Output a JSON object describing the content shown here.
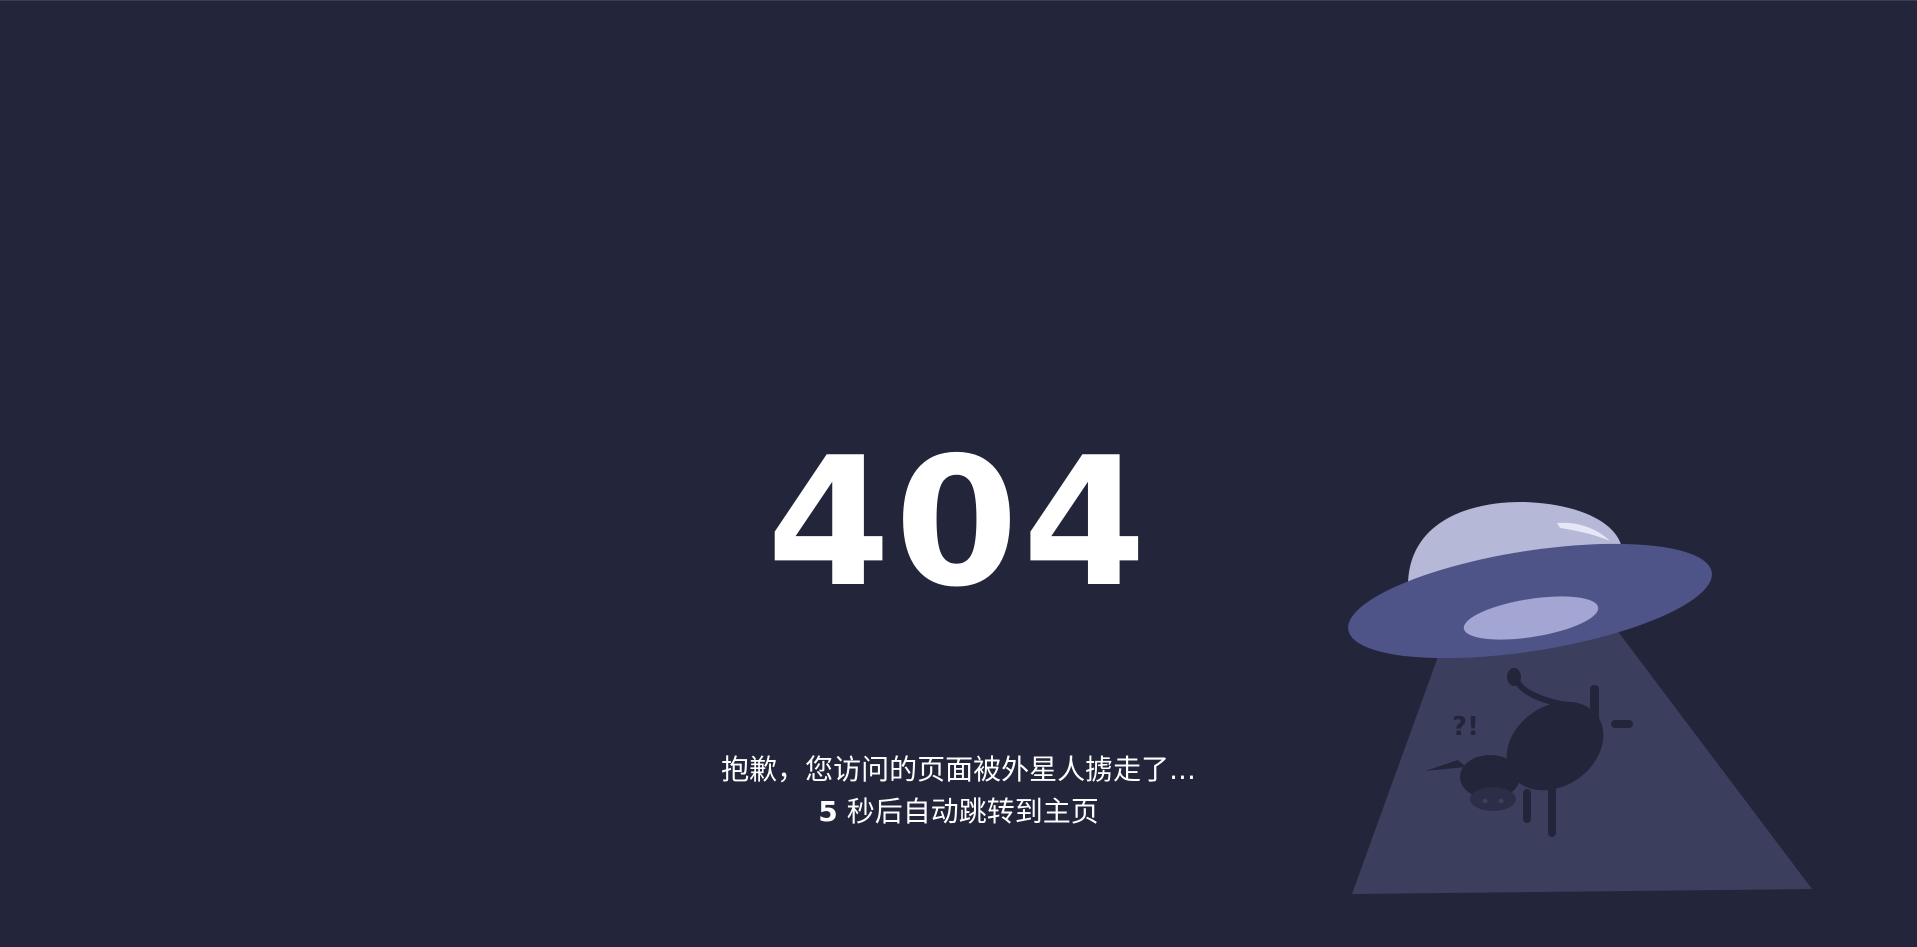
{
  "error": {
    "code": "404",
    "message": "抱歉，您访问的页面被外星人掳走了...",
    "countdown": "5",
    "redirect_text": "秒后自动跳转到主页"
  },
  "illustration": {
    "icon": "ufo-abducting-cow-illustration",
    "colors": {
      "background": "#23253b",
      "dome": "#b6b8d8",
      "saucer": "#4e5388",
      "saucer_highlight": "#a3a6d2",
      "beam": "#3c3e5e",
      "cow": "#23253b"
    }
  }
}
